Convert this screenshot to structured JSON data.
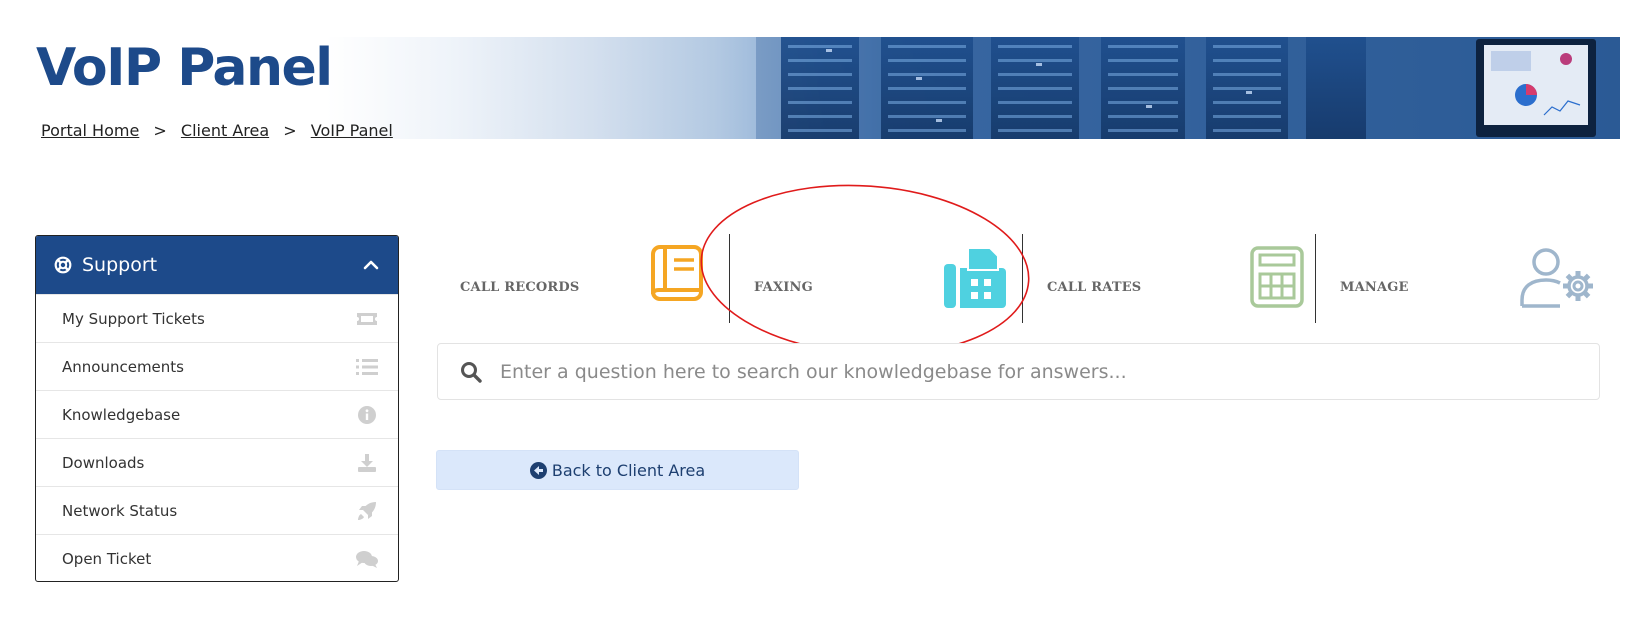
{
  "header": {
    "title": "VoIP Panel",
    "breadcrumb": [
      {
        "label": "Portal Home"
      },
      {
        "label": "Client Area"
      },
      {
        "label": "VoIP Panel"
      }
    ],
    "separator": ">"
  },
  "sidebar": {
    "title": "Support",
    "items": [
      {
        "label": "My Support Tickets",
        "icon": "ticket-icon"
      },
      {
        "label": "Announcements",
        "icon": "list-icon"
      },
      {
        "label": "Knowledgebase",
        "icon": "info-icon"
      },
      {
        "label": "Downloads",
        "icon": "download-icon"
      },
      {
        "label": "Network Status",
        "icon": "rocket-icon"
      },
      {
        "label": "Open Ticket",
        "icon": "comments-icon"
      }
    ]
  },
  "features": [
    {
      "label": "CALL RECORDS",
      "icon": "book-icon",
      "color": "#f5a623"
    },
    {
      "label": "FAXING",
      "icon": "fax-icon",
      "color": "#4fd1e0"
    },
    {
      "label": "CALL RATES",
      "icon": "calculator-icon",
      "color": "#a9c99a"
    },
    {
      "label": "MANAGE",
      "icon": "user-settings-icon",
      "color": "#9fb6cc"
    }
  ],
  "search": {
    "placeholder": "Enter a question here to search our knowledgebase for answers..."
  },
  "back_button": {
    "label": "Back to Client Area"
  },
  "colors": {
    "brand": "#1d4a8a",
    "annotation": "#e01b1b"
  }
}
